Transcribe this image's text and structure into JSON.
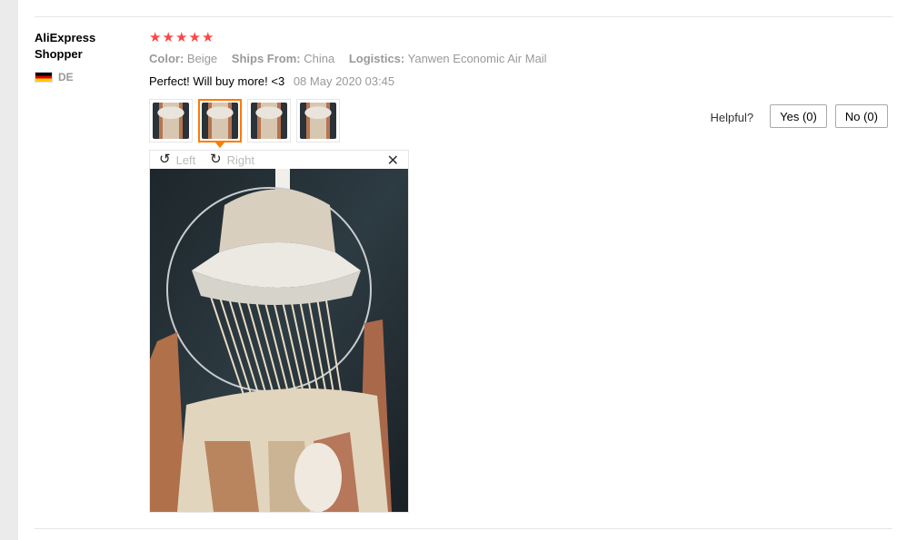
{
  "review": {
    "user_name": "AliExpress Shopper",
    "country_code": "DE",
    "rating_stars": 5,
    "star_glyph": "★",
    "star_color": "#ff4747",
    "color_key": "Color:",
    "color_val": "Beige",
    "ships_key": "Ships From:",
    "ships_val": "China",
    "logistics_key": "Logistics:",
    "logistics_val": "Yanwen Economic Air Mail",
    "comment": "Perfect! Will buy more! <3",
    "date": "08 May 2020 03:45",
    "thumbnails": 4,
    "active_thumbnail": 2
  },
  "helpful": {
    "label": "Helpful?",
    "yes": "Yes (0)",
    "no": "No (0)"
  },
  "viewer": {
    "left_label": "Left",
    "right_label": "Right",
    "left_icon": "rotate-left-icon",
    "right_icon": "rotate-right-icon",
    "close_icon": "close-icon",
    "close_glyph": "✕",
    "left_glyph": "↺",
    "right_glyph": "↻"
  }
}
